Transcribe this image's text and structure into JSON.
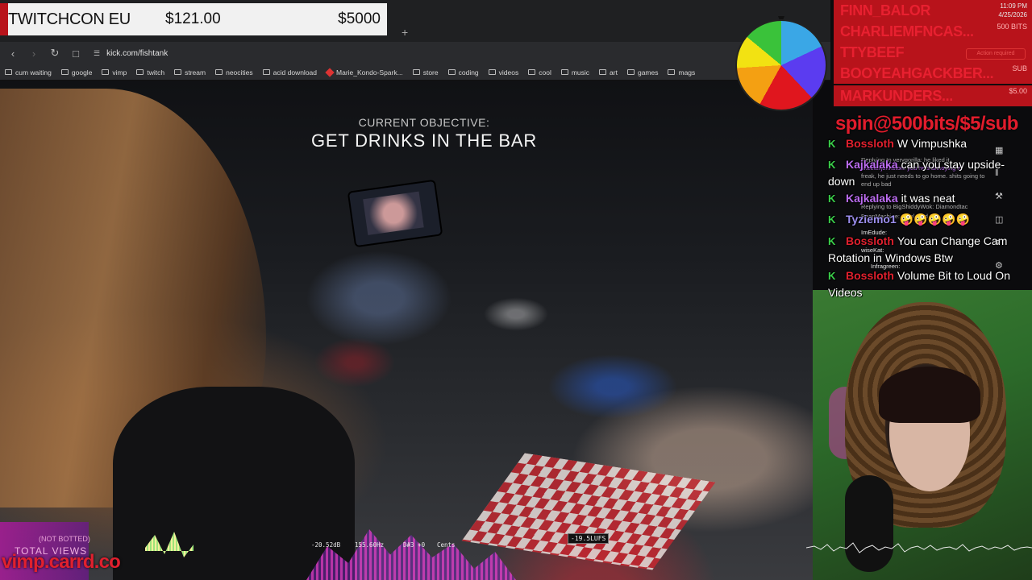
{
  "donation": {
    "title": "TWITCHCON EU",
    "amount": "$121.00",
    "goal": "$5000"
  },
  "browser": {
    "new_tab": "+",
    "url": "kick.com/fishtank",
    "bookmarks": [
      "cum waiting",
      "google",
      "vimp",
      "twitch",
      "stream",
      "neocities",
      "acid download",
      "Marie_Kondo-Spark...",
      "store",
      "coding",
      "videos",
      "cool",
      "music",
      "art",
      "games",
      "mags"
    ]
  },
  "objective": {
    "label": "CURRENT OBJECTIVE:",
    "text": "GET DRINKS IN THE BAR"
  },
  "alerts": [
    {
      "name": "FINN_BALOR"
    },
    {
      "name": "CHARLIEMFNCAS..."
    },
    {
      "name": "TTYBEEF"
    },
    {
      "name": "BOOYEAHGACKBER..."
    },
    {
      "name": "MARKUNDERS..."
    }
  ],
  "alert_meta": {
    "time": "11:09 PM",
    "date": "4/25/2026",
    "bits": "500 BITS",
    "sub": "SUB",
    "amount": "$5.00",
    "action_required": "Action required"
  },
  "spin_banner": "spin@500bits/$5/sub",
  "chat": [
    {
      "user": "Bossloth",
      "message": "W Vimpushka"
    },
    {
      "user": "Kajkalaka",
      "message": "can you stay upside-down"
    },
    {
      "user": "Kajkalaka",
      "message": "it was neat"
    },
    {
      "user": "Tyziemo1",
      "message": "🤪🤪🤪🤪🤪"
    },
    {
      "user": "Bossloth",
      "message": "You can Change Cam Rotation in Windows Btw"
    },
    {
      "user": "Bossloth",
      "message": "Volume Bit to Loud On Videos"
    }
  ],
  "chat_replies": [
    "Replying to verygorilla: he liked it",
    "skeeterjohnston: yea he's annoying af",
    "freak, he just needs to go home. shits going to",
    "end up bad",
    "Replying to BigShiddyWok: Diamondtac",
    "BeanMachine: thank god",
    "ImEdude:",
    "wiseKat:",
    "Infragreen:"
  ],
  "visualizer": {
    "db": "-20.52dB",
    "freq": "155.60Hz",
    "note": "D#3 +0",
    "cents": "Cents",
    "lufs": "-19.5LUFS"
  },
  "watermark": {
    "not_botted": "(NOT BOTTED)",
    "total_views": "TOTAL VIEWS",
    "site": "vimp.carrd.co"
  }
}
